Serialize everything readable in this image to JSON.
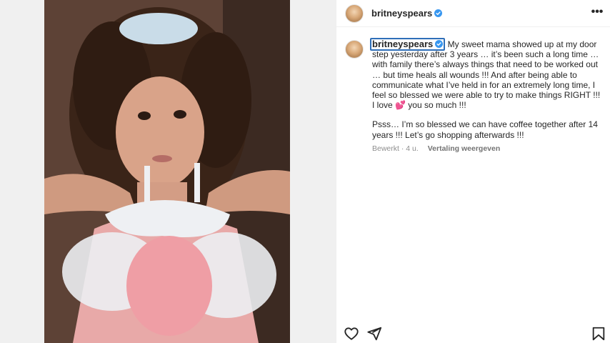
{
  "post": {
    "username": "britneyspears",
    "caption_lines": [
      "My sweet mama showed up at my door step yesterday after 3 years … it’s been such a long time … with family there’s always things that need to be worked out … but time heals all wounds !!! And after being able to communicate what I’ve held in for an extremely long time, I feel so blessed we were able to try to make things RIGHT !!! I love 💕 you so much !!!",
      "Psss… I’m so blessed we can have coffee together after 14 years !!! Let’s go shopping afterwards !!!"
    ],
    "edited_label": "Bewerkt",
    "separator": "·",
    "time_ago": "4 u.",
    "translate_label": "Vertaling weergeven",
    "more_icon": "•••"
  },
  "icons": {
    "verified": "verified-badge-icon",
    "more": "more-options-icon",
    "like": "heart-icon",
    "share": "paper-plane-icon",
    "save": "bookmark-icon"
  },
  "colors": {
    "verified_blue": "#3897f0",
    "focus_outline": "#2f6fb8",
    "meta_gray": "#8e8e8e"
  }
}
